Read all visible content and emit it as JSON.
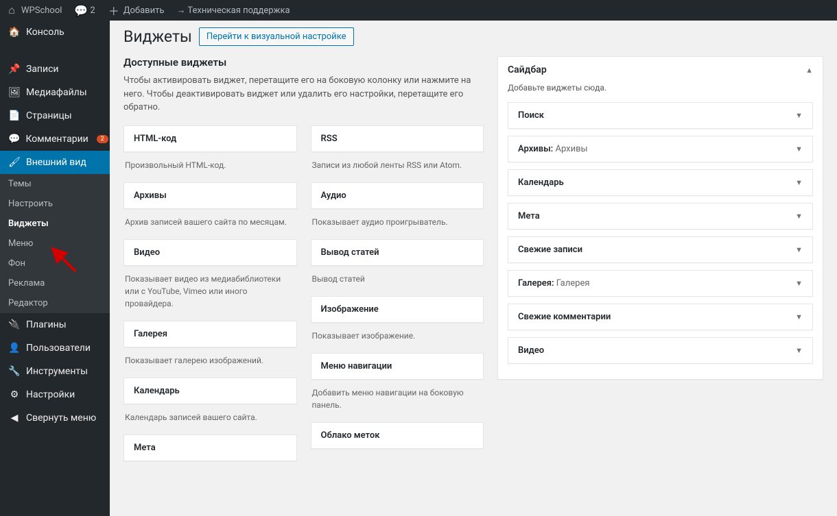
{
  "toolbar": {
    "site": "WPSchool",
    "comments": "2",
    "add": "Добавить",
    "support": "→ Техническая поддержка"
  },
  "sidebar": {
    "items": [
      {
        "icon": "🏠",
        "label": "Консоль"
      },
      {
        "icon": "📌",
        "label": "Записи"
      },
      {
        "icon": "🖼",
        "label": "Медиафайлы"
      },
      {
        "icon": "📄",
        "label": "Страницы"
      },
      {
        "icon": "💬",
        "label": "Комментарии",
        "badge": "2"
      },
      {
        "icon": "🖌",
        "label": "Внешний вид",
        "current": true
      },
      {
        "icon": "🔌",
        "label": "Плагины"
      },
      {
        "icon": "👤",
        "label": "Пользователи"
      },
      {
        "icon": "🔧",
        "label": "Инструменты"
      },
      {
        "icon": "⚙",
        "label": "Настройки"
      },
      {
        "icon": "◀",
        "label": "Свернуть меню"
      }
    ],
    "submenu": [
      {
        "label": "Темы"
      },
      {
        "label": "Настроить"
      },
      {
        "label": "Виджеты",
        "current": true
      },
      {
        "label": "Меню"
      },
      {
        "label": "Фон"
      },
      {
        "label": "Реклама"
      },
      {
        "label": "Редактор"
      }
    ]
  },
  "page": {
    "title": "Виджеты",
    "action": "Перейти к визуальной настройке"
  },
  "available": {
    "title": "Доступные виджеты",
    "desc": "Чтобы активировать виджет, перетащите его на боковую колонку или нажмите на него. Чтобы деактивировать виджет или удалить его настройки, перетащите его обратно.",
    "left": [
      {
        "title": "HTML-код",
        "desc": "Произвольный HTML-код."
      },
      {
        "title": "Архивы",
        "desc": "Архив записей вашего сайта по месяцам."
      },
      {
        "title": "Видео",
        "desc": "Показывает видео из медиабиблиотеки или с YouTube, Vimeo или иного провайдера."
      },
      {
        "title": "Галерея",
        "desc": "Показывает галерею изображений."
      },
      {
        "title": "Календарь",
        "desc": "Календарь записей вашего сайта."
      },
      {
        "title": "Мета",
        "desc": ""
      }
    ],
    "right": [
      {
        "title": "RSS",
        "desc": "Записи из любой ленты RSS или Atom."
      },
      {
        "title": "Аудио",
        "desc": "Показывает аудио проигрыватель."
      },
      {
        "title": "Вывод статей",
        "desc": "Вывод статей"
      },
      {
        "title": "Изображение",
        "desc": "Показывает изображение."
      },
      {
        "title": "Меню навигации",
        "desc": "Добавить меню навигации на боковую панель."
      },
      {
        "title": "Облако меток",
        "desc": ""
      }
    ]
  },
  "areas": [
    {
      "title": "Сайдбар",
      "desc": "Добавьте виджеты сюда.",
      "widgets": [
        {
          "title": "Поиск",
          "subtitle": ""
        },
        {
          "title": "Архивы:",
          "subtitle": "Архивы"
        },
        {
          "title": "Календарь",
          "subtitle": ""
        },
        {
          "title": "Мета",
          "subtitle": ""
        },
        {
          "title": "Свежие записи",
          "subtitle": ""
        },
        {
          "title": "Галерея:",
          "subtitle": "Галерея"
        },
        {
          "title": "Свежие комментарии",
          "subtitle": ""
        },
        {
          "title": "Видео",
          "subtitle": ""
        }
      ]
    }
  ]
}
